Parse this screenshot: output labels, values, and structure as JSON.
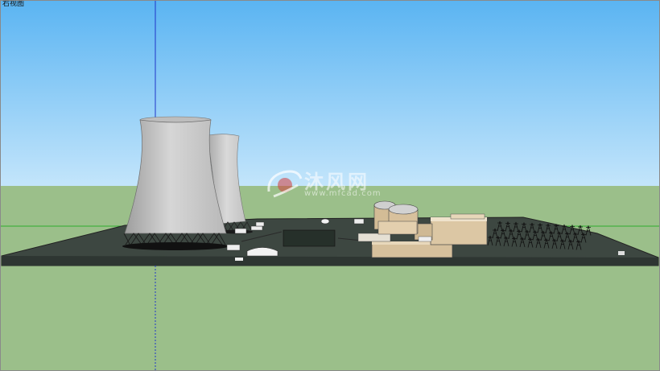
{
  "view": {
    "label": "右视图"
  },
  "watermark": {
    "brand": "沐风网",
    "url": "www.mfcad.com"
  },
  "colors": {
    "sky_top": "#5ab4f2",
    "sky_bottom": "#bfe3fb",
    "ground": "#9bbf8a",
    "site_pad": "#3c4640",
    "tower": "#c8c8c8",
    "building": "#d8c3a0",
    "axis_blue": "#1f35c8",
    "axis_green": "#2fae2f"
  },
  "icons": {
    "watermark_logo": "mf-logo-icon"
  }
}
